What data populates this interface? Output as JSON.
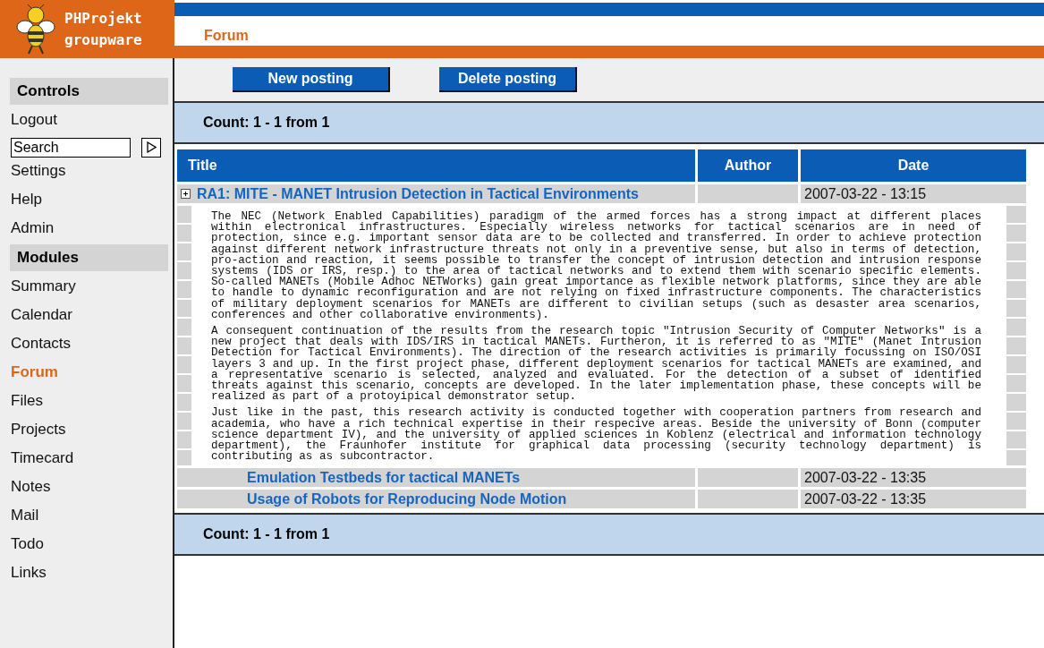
{
  "logo": {
    "line1": "PHProjekt",
    "line2": "groupware"
  },
  "page_title": "Forum",
  "sidebar": {
    "sections": [
      {
        "heading": "Controls",
        "items": [
          {
            "kind": "link",
            "label": "Logout",
            "selected": false
          },
          {
            "kind": "search",
            "value": "Search"
          },
          {
            "kind": "link",
            "label": "Settings",
            "selected": false
          },
          {
            "kind": "link",
            "label": "Help",
            "selected": false
          },
          {
            "kind": "link",
            "label": "Admin",
            "selected": false
          }
        ]
      },
      {
        "heading": "Modules",
        "items": [
          {
            "kind": "link",
            "label": "Summary",
            "selected": false
          },
          {
            "kind": "link",
            "label": "Calendar",
            "selected": false
          },
          {
            "kind": "link",
            "label": "Contacts",
            "selected": false
          },
          {
            "kind": "link",
            "label": "Forum",
            "selected": true
          },
          {
            "kind": "link",
            "label": "Files",
            "selected": false
          },
          {
            "kind": "link",
            "label": "Projects",
            "selected": false
          },
          {
            "kind": "link",
            "label": "Timecard",
            "selected": false
          },
          {
            "kind": "link",
            "label": "Notes",
            "selected": false
          },
          {
            "kind": "link",
            "label": "Mail",
            "selected": false
          },
          {
            "kind": "link",
            "label": "Todo",
            "selected": false
          },
          {
            "kind": "link",
            "label": "Links",
            "selected": false
          }
        ]
      }
    ]
  },
  "toolbar": {
    "buttons": [
      "New posting",
      "Delete posting"
    ]
  },
  "count_top": "Count: 1 - 1 from 1",
  "table": {
    "columns": [
      "Title",
      "Author",
      "Date"
    ],
    "rows": [
      {
        "title": "RA1: MITE - MANET Intrusion Detection in Tactical Environments",
        "date": "2007-03-22 - 13:15",
        "expanded": true,
        "body": [
          "The NEC (Network Enabled Capabilities) paradigm of the armed forces has a strong impact at different places within electronical infrastructures. Especially wireless networks for tactical scenarios are in need of protection, since e.g. important sensor data are to be collected and transferred. In order to achieve protection against different network infrastructure threats not only in a preventive sense, but also in terms of detection, pro-action and reaction, it seems possible to transfer the concept of intrusion detection and intrusion response systems (IDS or IRS, resp.) to the area of tactical networks and to extend them with scenario specific elements. So-called MANETs (Mobile Adhoc NETWorks) gain great importance as flexible network platforms, since they are able to handle to dynamic reconfiguration and are not relying on fixed infrastructure components. The characteristics of military deployment scenarios for MANETs are different to civilian setups (such as desaster area scenarios, conferences and other collaborative environments).",
          "A consequent continuation of the results from the research topic \"Intrusion Security of Computer Networks\" is a new project that deals with IDS/IRS in tactical MANETs. Furtheron, it is referred to as \"MITE\" (Manet Intrusion Detection for Tactical Environments). The direction of the research activities is primarily focussing on ISO/OSI layers 3 and up. In the first project phase, different deployment scenarios for tactical MANETs are examined, and a representative scenario is selected, analyzed and evaluated. For the detection of a subset of identified threats against this scenario, concepts are developed. In the later implementation phase, these concepts will be realized as part of a protoyipical demonstrator setup.",
          "Just like in the past, this research activity is conducted together with cooperation partners from research and academia, who have a rich technical expertise in their respecive areas. Beside the university of Bonn (computer science department IV), and the university of applied sciences in Koblenz (electrical and information technology department), the Fraunhofer institute for graphical data processing (security technology department) is contributing as as subcontractor."
        ],
        "children": [
          {
            "title": "Emulation Testbeds for tactical MANETs",
            "date": "2007-03-22 - 13:35"
          },
          {
            "title": "Usage of Robots for Reproducing Node Motion",
            "date": "2007-03-22 - 13:35"
          }
        ]
      }
    ]
  },
  "count_bottom": "Count: 1 - 1 from 1"
}
